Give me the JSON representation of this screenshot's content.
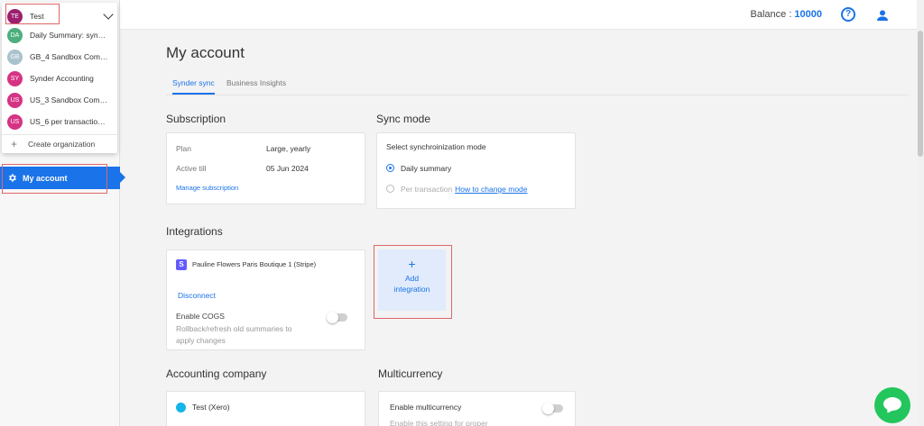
{
  "header": {
    "balance_label": "Balance :",
    "balance_value": "10000",
    "help_symbol": "?"
  },
  "org_switcher": {
    "current": {
      "initials": "TE",
      "name": "Test",
      "color": "#9c1f6e"
    },
    "items": [
      {
        "initials": "DA",
        "name": "Daily Summary: sync ...",
        "color": "#4caf7d"
      },
      {
        "initials": "GB",
        "name": "GB_4 Sandbox Comp...",
        "color": "#a8c3cc"
      },
      {
        "initials": "SY",
        "name": "Synder Accounting",
        "color": "#d63384"
      },
      {
        "initials": "US",
        "name": "US_3 Sandbox Comp...",
        "color": "#d63384"
      },
      {
        "initials": "US",
        "name": "US_6 per transaction ...",
        "color": "#d63384"
      }
    ],
    "create_plus": "+",
    "create_label": "Create organization"
  },
  "sidebar": {
    "my_account_label": "My account"
  },
  "page": {
    "title": "My account",
    "tabs": [
      "Synder sync",
      "Business Insights"
    ]
  },
  "subscription": {
    "title": "Subscription",
    "plan_label": "Plan",
    "plan_value": "Large, yearly",
    "active_label": "Active till",
    "active_value": "05 Jun 2024",
    "manage_link": "Manage subscription"
  },
  "sync_mode": {
    "title": "Sync mode",
    "heading": "Select synchroinization mode",
    "option_daily": "Daily summary",
    "option_per_tx": "Per transaction",
    "how_link": "How to change mode"
  },
  "integrations": {
    "title": "Integrations",
    "stripe_logo": "S",
    "card_name": "Pauline Flowers Paris Boutique 1 (Stripe)",
    "disconnect": "Disconnect",
    "cogs_label": "Enable COGS",
    "cogs_sub": "Rollback/refresh old summaries to apply changes",
    "add_plus": "+",
    "add_label_1": "Add",
    "add_label_2": "integration"
  },
  "accounting": {
    "title": "Accounting company",
    "company_name": "Test (Xero)"
  },
  "multicurrency": {
    "title": "Multicurrency",
    "label": "Enable multicurrency",
    "sub": "Enable this setting for proper"
  },
  "colors": {
    "accent": "#1a73e8",
    "highlight_box": "#e06666",
    "chat": "#23c65c"
  }
}
